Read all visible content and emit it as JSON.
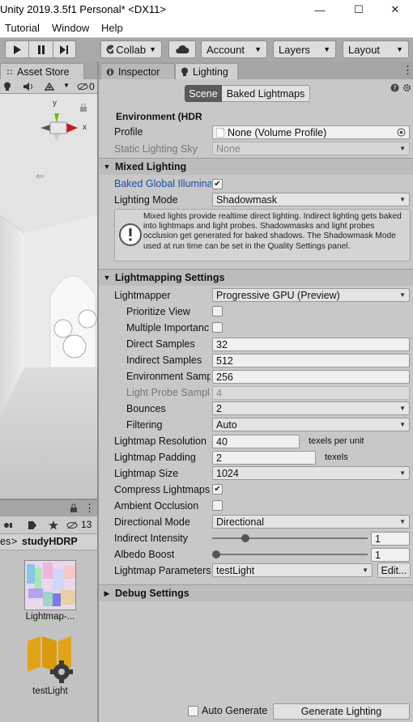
{
  "window": {
    "title": "Unity 2019.3.5f1 Personal* <DX11>",
    "controls": [
      "—",
      "☐",
      "✕"
    ]
  },
  "menubar": [
    "Tutorial",
    "Window",
    "Help"
  ],
  "toolbar": {
    "collab": "Collab",
    "account": "Account",
    "layers": "Layers",
    "layout": "Layout"
  },
  "left_panel": {
    "tab": "Asset Store",
    "hidden_count": "0",
    "bottom_count": "13",
    "breadcrumb_prefix": "es",
    "breadcrumb_folder": "studyHDRP",
    "assets": [
      {
        "label": "Lightmap-..."
      },
      {
        "label": "testLight"
      }
    ],
    "gizmo_axes": {
      "y": "y",
      "x": "x"
    }
  },
  "inspector_tabs": {
    "inspector": "Inspector",
    "lighting": "Lighting"
  },
  "subtabs": {
    "scene": "Scene",
    "baked": "Baked Lightmaps"
  },
  "environment": {
    "header": "Environment (HDR",
    "profile_label": "Profile",
    "profile_value": "None (Volume Profile)",
    "static_sky_label": "Static Lighting Sky",
    "static_sky_value": "None"
  },
  "mixed_lighting": {
    "header": "Mixed Lighting",
    "baked_gi_label": "Baked Global Illumina",
    "baked_gi_checked": true,
    "lighting_mode_label": "Lighting Mode",
    "lighting_mode_value": "Shadowmask",
    "info": "Mixed lights provide realtime direct lighting. Indirect lighting gets baked into lightmaps and light probes. Shadowmasks and light probes occlusion get generated for baked shadows. The Shadowmask Mode used at run time can be set in the Quality Settings panel."
  },
  "lightmapping": {
    "header": "Lightmapping Settings",
    "lightmapper_label": "Lightmapper",
    "lightmapper_value": "Progressive GPU (Preview)",
    "prioritize_view_label": "Prioritize View",
    "multiple_importance_label": "Multiple Importanc",
    "direct_samples_label": "Direct Samples",
    "direct_samples": "32",
    "indirect_samples_label": "Indirect Samples",
    "indirect_samples": "512",
    "environment_samples_label": "Environment Samp",
    "environment_samples": "256",
    "light_probe_label": "Light Probe Sampl",
    "light_probe": "4",
    "bounces_label": "Bounces",
    "bounces": "2",
    "filtering_label": "Filtering",
    "filtering": "Auto",
    "resolution_label": "Lightmap Resolution",
    "resolution": "40",
    "resolution_unit": "texels per unit",
    "padding_label": "Lightmap Padding",
    "padding": "2",
    "padding_unit": "texels",
    "size_label": "Lightmap Size",
    "size": "1024",
    "compress_label": "Compress Lightmaps",
    "compress_checked": true,
    "ao_label": "Ambient Occlusion",
    "ao_checked": false,
    "directional_label": "Directional Mode",
    "directional": "Directional",
    "indirect_intensity_label": "Indirect Intensity",
    "indirect_intensity": "1",
    "indirect_intensity_fraction": 0.2,
    "albedo_label": "Albedo Boost",
    "albedo_boost": "1",
    "albedo_boost_fraction": 0.0,
    "params_label": "Lightmap Parameters",
    "params": "testLight",
    "edit_button": "Edit..."
  },
  "debug": {
    "header": "Debug Settings"
  },
  "footer": {
    "auto_generate": "Auto Generate",
    "auto_generate_checked": false,
    "generate_button": "Generate Lighting"
  }
}
